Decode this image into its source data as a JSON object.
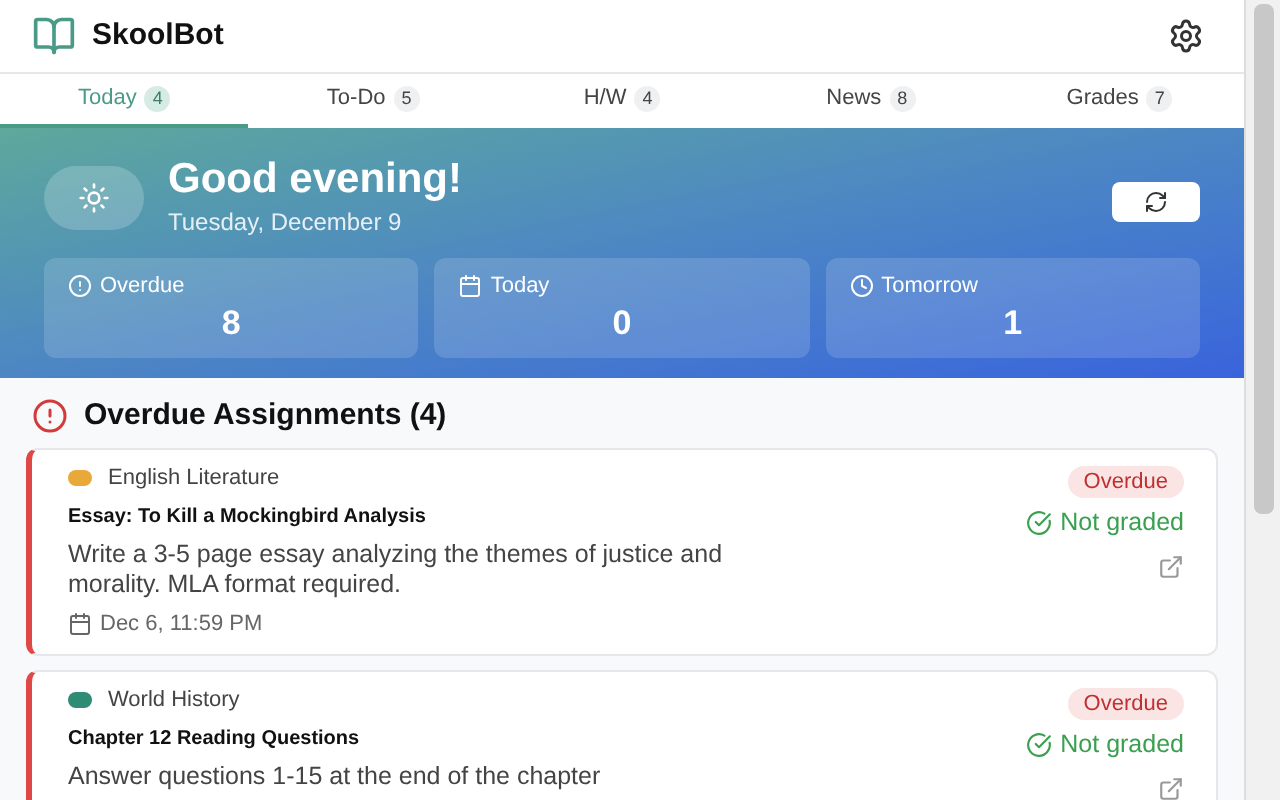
{
  "app": {
    "title": "SkoolBot"
  },
  "tabs": [
    {
      "label": "Today",
      "count": "4",
      "selected": true
    },
    {
      "label": "To-Do",
      "count": "5",
      "selected": false
    },
    {
      "label": "H/W",
      "count": "4",
      "selected": false
    },
    {
      "label": "News",
      "count": "8",
      "selected": false
    },
    {
      "label": "Grades",
      "count": "7",
      "selected": false
    }
  ],
  "hero": {
    "greeting": "Good evening!",
    "date": "Tuesday, December 9",
    "stats": [
      {
        "kind": "overdue",
        "label": "Overdue",
        "value": "8"
      },
      {
        "kind": "today",
        "label": "Today",
        "value": "0"
      },
      {
        "kind": "tomorrow",
        "label": "Tomorrow",
        "value": "1"
      }
    ]
  },
  "section": {
    "title": "Overdue Assignments (4)"
  },
  "assignments": [
    {
      "course": "English Literature",
      "color": "#e9a93a",
      "title": "Essay: To Kill a Mockingbird Analysis",
      "description": "Write a 3-5 page essay analyzing the themes of justice and morality. MLA format required.",
      "due": "Dec 6, 11:59 PM",
      "status": "Overdue",
      "grade": "Not graded"
    },
    {
      "course": "World History",
      "color": "#2e8b74",
      "title": "Chapter 12 Reading Questions",
      "description": "Answer questions 1-15 at the end of the chapter",
      "status": "Overdue",
      "grade": "Not graded"
    }
  ]
}
